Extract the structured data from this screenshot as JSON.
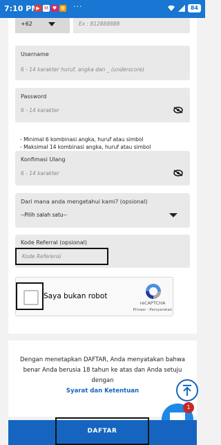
{
  "status_bar": {
    "time": "7:10 PM",
    "app_icons": [
      "youtube-icon",
      "gmail-icon",
      "heart-icon",
      "gallery-icon"
    ],
    "more": "···",
    "battery": "84"
  },
  "form": {
    "country_code": "+62",
    "phone_placeholder": "Ex : 812888888",
    "username_label": "Username",
    "username_placeholder": "6 - 14 karakter huruf, angka dan _ (underscore)",
    "password_label": "Password",
    "password_placeholder": "6 - 14 karakter",
    "password_rules": [
      "- Minimal 6 kombinasi angka, huruf atau simbol",
      "- Maksimal 14 kombinasi angka, huruf atau simbol"
    ],
    "confirm_label": "Konfimasi Ulang",
    "confirm_placeholder": "6 - 14 karakter",
    "source_label": "Dari mana anda mengetahui kami? (opsional)",
    "source_selected": "--Pilih salah satu--",
    "referral_label": "Kode Referral (opsional)",
    "referral_placeholder": "Kode Referensi"
  },
  "captcha": {
    "label": "Saya bukan robot",
    "brand": "reCAPTCHA",
    "links": "Privasi - Persyaratan"
  },
  "terms": {
    "text": "Dengan menetapkan DAFTAR, Anda menyatakan bahwa benar Anda berusia 18 tahun ke atas dan Anda setuju dengan",
    "link": "Syarat dan Ketentuan"
  },
  "chat_badge": "1",
  "submit_label": "DAFTAR",
  "colors": {
    "primary": "#1565c0",
    "status_bar": "#1976d2",
    "badge": "#c62828"
  }
}
